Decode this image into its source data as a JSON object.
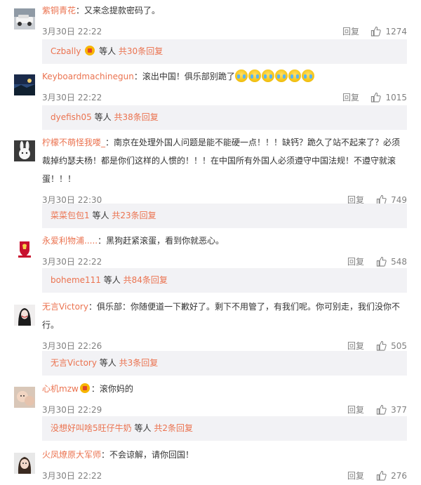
{
  "labels": {
    "reply": "回复",
    "others": "等人",
    "separator": "："
  },
  "colors": {
    "link": "#eb7350",
    "meta": "#808080",
    "subbg": "#f2f2f5"
  },
  "comments": [
    {
      "user": "紫铜青花",
      "text": "又来念提款密码了。",
      "time": "3月30日 22:22",
      "likes": "1274",
      "avatar_icon": "car-avatar-icon",
      "sub": {
        "user": "Czbally",
        "total": "共30条回复",
        "badge": true
      }
    },
    {
      "user": "Keyboardmachinegun",
      "text": "滚出中国！俱乐部别跪了",
      "time": "3月30日 22:22",
      "likes": "1015",
      "avatar_icon": "landscape-avatar-icon",
      "emojis": 6,
      "sub": {
        "user": "dyefish05",
        "total": "共38条回复"
      }
    },
    {
      "user": "柠檬不萌怪我喽_",
      "text": "南京在处理外国人问题是能不能硬一点！！！缺钙？跪久了站不起来了？必须裁掉约瑟夫杨！都是你们这样的人惯的！！！在中国所有外国人必须遵守中国法规！不遵守就滚蛋！！！",
      "time": "3月30日 22:30",
      "likes": "749",
      "avatar_icon": "rabbit-avatar-icon",
      "sub": {
        "user": "菜菜包包1",
        "total": "共23条回复"
      }
    },
    {
      "user": "永爱利物浦.....",
      "text": "黑狗赶紧滚蛋，看到你就恶心。",
      "time": "3月30日 22:22",
      "likes": "548",
      "avatar_icon": "liverpool-crest-avatar-icon",
      "sub": {
        "user": "boheme111",
        "total": "共84条回复"
      }
    },
    {
      "user": "无言Victory",
      "text": "俱乐部：你随便道一下歉好了。剩下不用管了，有我们呢。你可别走，我们没你不行。",
      "time": "3月30日 22:26",
      "likes": "505",
      "avatar_icon": "portrait-avatar-icon",
      "sub": {
        "user": "无言Victory",
        "total": "共3条回复"
      }
    },
    {
      "user": "心机mzw",
      "text": "滚你妈的",
      "time": "3月30日 22:29",
      "likes": "377",
      "avatar_icon": "baby-avatar-icon",
      "badge": true,
      "sub": {
        "user": "没想好叫啥5旺仔牛奶",
        "total": "共2条回复"
      }
    },
    {
      "user": "火凤燎原大军师",
      "text": "不会谅解，请你回国！",
      "time": "3月30日 22:22",
      "likes": "276",
      "avatar_icon": "child-avatar-icon"
    }
  ]
}
